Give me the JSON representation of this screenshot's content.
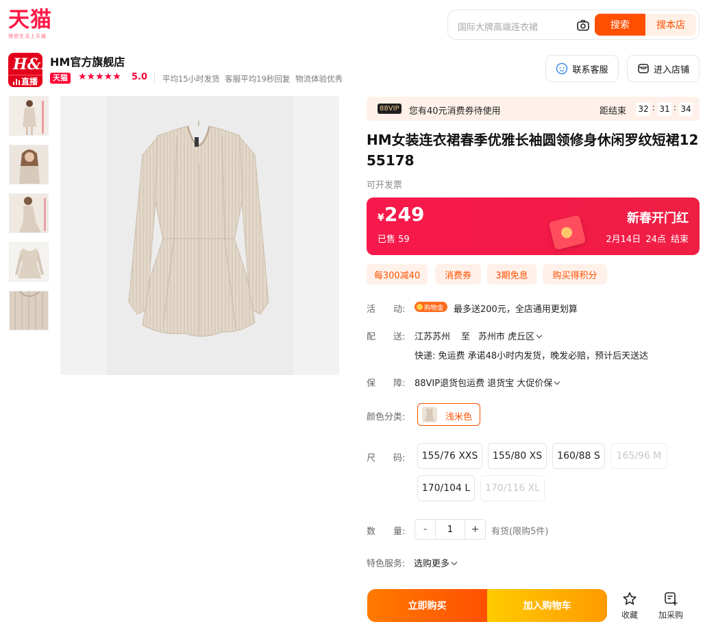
{
  "header": {
    "logo_text": "天猫",
    "logo_slogan": "理想生活上天猫",
    "search_placeholder": "国际大牌高端连衣裙",
    "search_button": "搜索",
    "store_search_button": "搜本店"
  },
  "shop": {
    "logo_text": "H&M",
    "live_label": "直播",
    "name": "HM官方旗舰店",
    "tmall_tag": "天猫",
    "stars": "★★★★★",
    "rating": "5.0",
    "stats": "平均15小时发货 客服平均19秒回复 物流体验优秀",
    "customer_service": "联系客服",
    "enter_store": "进入店铺"
  },
  "vip": {
    "badge": "88VIP",
    "text": "您有40元消费券待使用",
    "countdown_label": "距结束",
    "countdown": [
      "32",
      "31",
      "34"
    ],
    "sep": ":"
  },
  "product": {
    "title": "HM女装连衣裙春季优雅长袖圆领修身休闲罗纹短裙1255178",
    "invoice": "可开发票",
    "price_symbol": "¥",
    "price": "249",
    "sold": "已售 59",
    "promo_title": "新春开门红",
    "promo_date": "2月14日 24点 结束"
  },
  "tags": [
    "每300减40",
    "消费券",
    "3期免息",
    "购买得积分"
  ],
  "rows": {
    "activity_label": "活　　动:",
    "gift_tag": "购物金",
    "activity_text": "最多送200元，全店通用更划算",
    "delivery_label": "配　　送:",
    "delivery_from": "江苏苏州",
    "delivery_to_word": "至",
    "delivery_to": "苏州市 虎丘区",
    "delivery_detail": "快递: 免运费  承诺48小时内发货，晚发必赔，预计后天送达",
    "guarantee_label": "保　　障:",
    "guarantee_text": "88VIP退货包运费 退货宝 大促价保",
    "color_label": "颜色分类:",
    "color_name": "浅米色",
    "size_label": "尺　　码:",
    "qty_label": "数　　量:",
    "qty_minus": "-",
    "qty_value": "1",
    "qty_plus": "+",
    "stock": "有货(限购5件)",
    "service_label": "特色服务:",
    "service_text": "选购更多"
  },
  "sizes": [
    {
      "label": "155/76 XXS",
      "available": true
    },
    {
      "label": "155/80 XS",
      "available": true
    },
    {
      "label": "160/88 S",
      "available": true
    },
    {
      "label": "165/96 M",
      "available": false
    },
    {
      "label": "170/104 L",
      "available": true
    },
    {
      "label": "170/116 XL",
      "available": false
    }
  ],
  "actions": {
    "buy_now": "立即购买",
    "add_cart": "加入购物车",
    "favorite": "收藏",
    "add_purchase": "加采购"
  },
  "colors": {
    "brand_orange": "#ff5000",
    "tmall_red": "#ff0036",
    "price_red": "#f7194b",
    "dress_beige": "#e2d6c7"
  },
  "icons": [
    "camera-icon",
    "customer-service-icon",
    "store-icon",
    "star-icon",
    "purchase-list-icon",
    "chevron-down-icon"
  ]
}
